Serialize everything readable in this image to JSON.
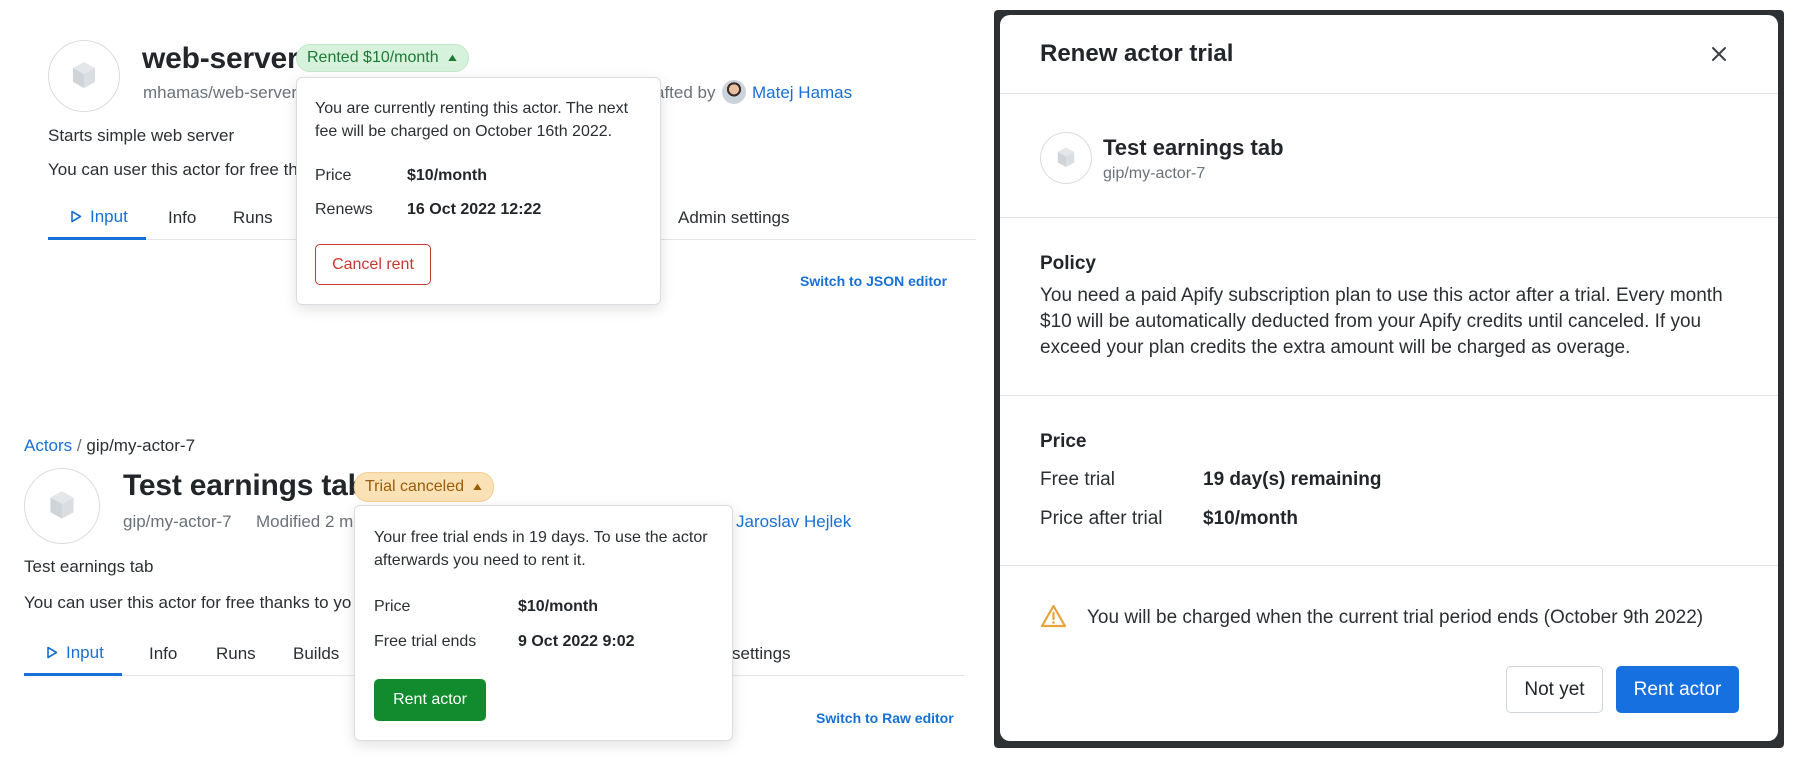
{
  "top_actor": {
    "title": "web-server",
    "badge": "Rented $10/month",
    "slug": "mhamas/web-server",
    "crafted_by_fragment": "afted by",
    "author": "Matej Hamas",
    "description": "Starts simple web server",
    "free_note_fragment": "You can user this actor for free tha",
    "tabs": [
      "Input",
      "Info",
      "Runs",
      "Admin settings"
    ],
    "switch_editor": "Switch to JSON editor",
    "popover": {
      "message": "You are currently renting this actor. The next fee will be charged on October 16th 2022.",
      "rows": [
        {
          "label": "Price",
          "value": "$10/month"
        },
        {
          "label": "Renews",
          "value": "16 Oct 2022 12:22"
        }
      ],
      "button": "Cancel rent"
    }
  },
  "bottom_actor": {
    "breadcrumb_link": "Actors",
    "breadcrumb_sep": "/",
    "breadcrumb_current": "gip/my-actor-7",
    "title": "Test earnings tab",
    "badge": "Trial canceled",
    "slug": "gip/my-actor-7",
    "modified_fragment": "Modified 2 m",
    "author": "Jaroslav Hejlek",
    "description": "Test earnings tab",
    "free_note_fragment": "You can user this actor for free thanks to yo",
    "tabs": [
      "Input",
      "Info",
      "Runs",
      "Builds",
      "settings"
    ],
    "switch_editor": "Switch to Raw editor",
    "popover": {
      "message": "Your free trial ends in 19 days. To use the actor afterwards you need to rent it.",
      "rows": [
        {
          "label": "Price",
          "value": "$10/month"
        },
        {
          "label": "Free trial ends",
          "value": "9 Oct 2022 9:02"
        }
      ],
      "button": "Rent actor"
    }
  },
  "modal": {
    "title": "Renew actor trial",
    "close_icon": "close-icon",
    "actor_title": "Test earnings tab",
    "actor_slug": "gip/my-actor-7",
    "policy_heading": "Policy",
    "policy_text": "You need a paid Apify subscription plan to use this actor after a trial. Every month $10 will be automatically deducted from your Apify credits until canceled. If you exceed your plan credits the extra amount will be charged as overage.",
    "price_heading": "Price",
    "rows": [
      {
        "label": "Free trial",
        "value": "19 day(s) remaining"
      },
      {
        "label": "Price after trial",
        "value": "$10/month"
      }
    ],
    "warning_icon": "warning-icon",
    "warning_text": "You will be charged when the current trial period ends (October 9th 2022)",
    "not_yet_button": "Not yet",
    "rent_button": "Rent actor"
  },
  "colors": {
    "link": "#1670d6",
    "primary_button": "#1670e0",
    "success_button": "#118b2e",
    "danger": "#c8372d",
    "rented_badge_bg": "#d7f2dc",
    "trial_badge_bg": "#fbe1b6",
    "warning": "#e8a33a"
  }
}
